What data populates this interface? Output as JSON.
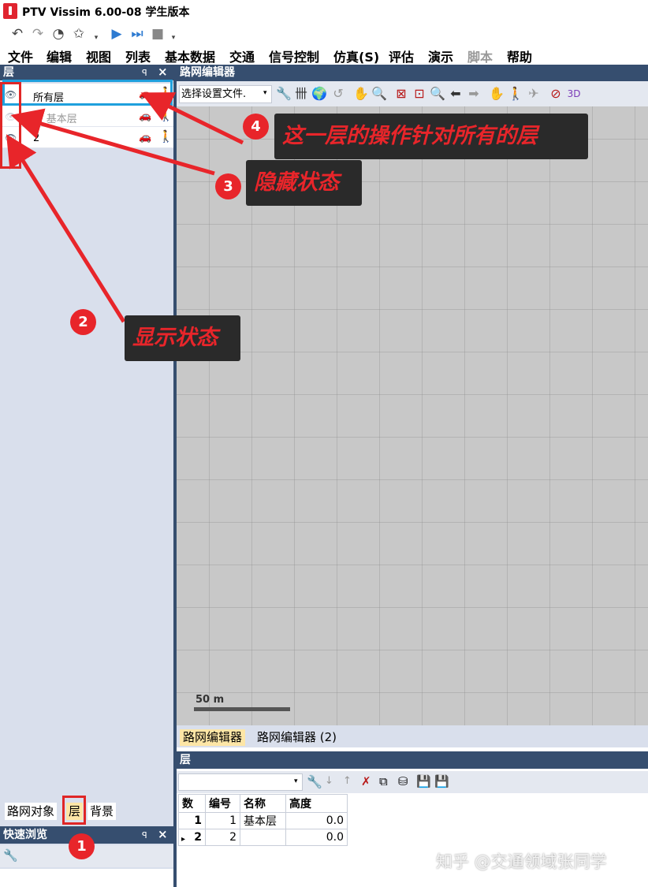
{
  "window": {
    "title": "PTV Vissim 6.00-08 学生版本"
  },
  "menu": [
    "文件",
    "编辑",
    "视图",
    "列表",
    "基本数据",
    "交通",
    "信号控制",
    "仿真(S)",
    "评估",
    "演示",
    "脚本",
    "帮助"
  ],
  "layers_panel": {
    "title": "层",
    "pin": "ꟼ",
    "close": "×",
    "rows": [
      {
        "name": "所有层",
        "visible": true
      },
      {
        "name": "1: 基本层",
        "visible": false
      },
      {
        "name": "2",
        "visible": true
      }
    ]
  },
  "left_tabs": [
    "路网对象",
    "层",
    "背景"
  ],
  "quick_view": {
    "title": "快速浏览"
  },
  "network_editor": {
    "title": "路网编辑器",
    "select_label": "选择设置文件.",
    "scale_label": "50 m"
  },
  "bottom_tabs": [
    "路网编辑器",
    "路网编辑器 (2)"
  ],
  "lower_list": {
    "title": "层",
    "columns": [
      "数",
      "编号",
      "名称",
      "高度"
    ],
    "rows": [
      {
        "count": "1",
        "id": "1",
        "name": "基本层",
        "height": "0.0"
      },
      {
        "count": "2",
        "id": "2",
        "name": "",
        "height": "0.0"
      }
    ]
  },
  "annotations": [
    {
      "num": "1",
      "text": ""
    },
    {
      "num": "2",
      "text": "显示状态"
    },
    {
      "num": "3",
      "text": "隐藏状态"
    },
    {
      "num": "4",
      "text": "这一层的操作针对所有的层"
    }
  ],
  "watermark": "知乎 @交通领域张同学",
  "colors": {
    "header_bg": "#364e6f",
    "panel_bg": "#d9dfec",
    "annotation_red": "#e8252a",
    "highlight_blue": "#1fa0dd"
  }
}
